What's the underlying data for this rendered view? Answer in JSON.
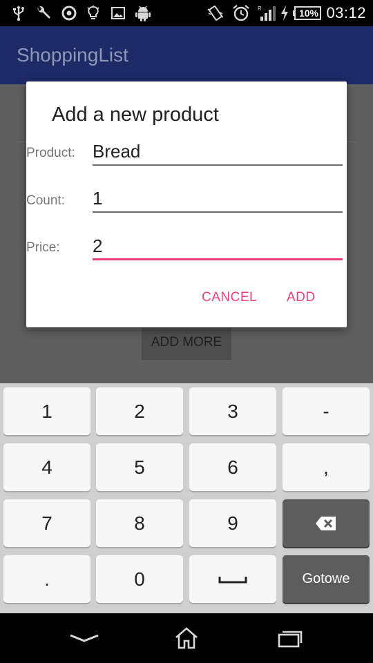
{
  "status_bar": {
    "battery_percent": "10%",
    "time": "03:12",
    "icons": [
      "usb-icon",
      "wrench-icon",
      "sync-icon",
      "lightbulb-icon",
      "image-icon",
      "android-icon",
      "vibrate-icon",
      "alarm-icon",
      "signal-icon",
      "charging-icon",
      "battery-icon"
    ]
  },
  "app_bar": {
    "title": "ShoppingList"
  },
  "background": {
    "add_more_label": "ADD MORE"
  },
  "dialog": {
    "title": "Add a new product",
    "fields": [
      {
        "label": "Product:",
        "value": "Bread"
      },
      {
        "label": "Count:",
        "value": "1"
      },
      {
        "label": "Price:",
        "value": "2"
      }
    ],
    "cancel_label": "CANCEL",
    "add_label": "ADD",
    "accent_color": "#ec407a"
  },
  "keyboard": {
    "keys": [
      "1",
      "2",
      "3",
      "-",
      "4",
      "5",
      "6",
      ",",
      "7",
      "8",
      "9",
      ".",
      "0"
    ],
    "done_label": "Gotowe",
    "special_icons": [
      "backspace-icon",
      "space-icon"
    ]
  },
  "nav_bar": {
    "icons": [
      "back-icon",
      "home-icon",
      "recents-icon"
    ]
  },
  "colors": {
    "app_bar": "#1e2a66",
    "dialog_bg": "#ffffff",
    "keyboard_bg": "#cfcfcf"
  }
}
